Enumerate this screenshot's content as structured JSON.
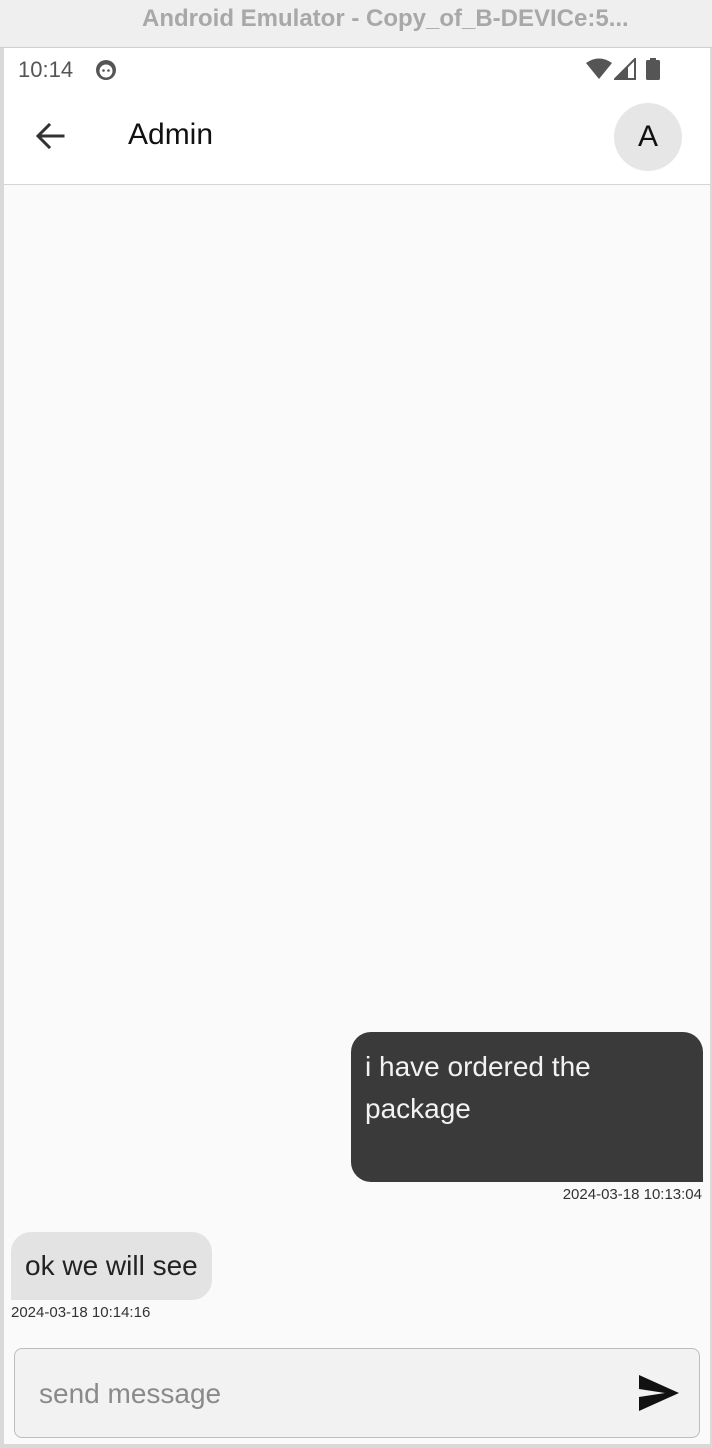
{
  "window": {
    "title": "Android Emulator - Copy_of_B-DEVICe:5..."
  },
  "status_bar": {
    "time": "10:14",
    "icons": [
      "notification-face-icon",
      "wifi-icon",
      "signal-icon",
      "battery-icon"
    ]
  },
  "app_bar": {
    "back_icon": "arrow-left-icon",
    "title": "Admin",
    "avatar_letter": "A"
  },
  "messages": [
    {
      "direction": "sent",
      "text": "i have ordered the package",
      "timestamp": "2024-03-18 10:13:04"
    },
    {
      "direction": "received",
      "text": "ok we will see",
      "timestamp": "2024-03-18 10:14:16"
    }
  ],
  "composer": {
    "value": "",
    "placeholder": "send message",
    "send_icon": "send-icon"
  },
  "colors": {
    "sent_bubble": "#3a3a3a",
    "received_bubble": "#e3e3e3",
    "background": "#fafafa"
  }
}
